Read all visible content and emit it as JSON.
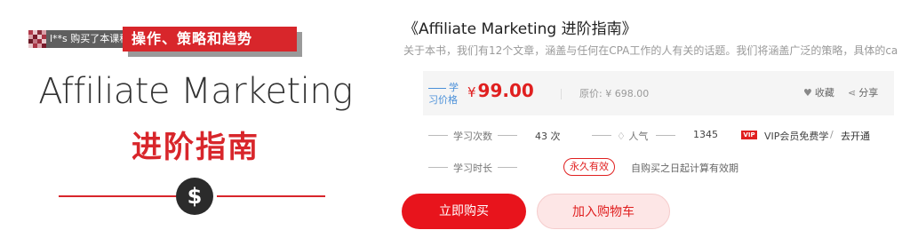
{
  "cover": {
    "toast_text": "l**s 购买了本课程",
    "banner": "操作、策略和趋势",
    "title": "Affiliate Marketing",
    "subtitle": "进阶指南",
    "symbol": "$"
  },
  "course": {
    "title": "《Affiliate Marketing 进阶指南》",
    "description": "关于本书，我们有12个文章，涵盖与任何在CPA工作的人有关的话题。我们将涵盖广泛的策略，具体的ca"
  },
  "price": {
    "label_line1": "学",
    "label_line2": "习价格",
    "currency": "¥",
    "value": "99.00",
    "original": "原价: ¥ 698.00",
    "favorite_label": "收藏",
    "share_label": "分享"
  },
  "stats": {
    "study_count_label": "学习次数",
    "study_count_value": "43 次",
    "popularity_label": "人气",
    "popularity_value": "1345",
    "vip_badge": "VIP",
    "vip_text": "VIP会员免费学",
    "vip_separator": "/",
    "vip_link": "去开通",
    "duration_label": "学习时长",
    "duration_badge": "永久有效",
    "duration_note": "自购买之日起计算有效期"
  },
  "actions": {
    "buy_label": "立即购买",
    "cart_label": "加入购物车"
  },
  "colors": {
    "accent": "#e02020",
    "banner": "#d8262b",
    "link": "#4a90d9"
  }
}
